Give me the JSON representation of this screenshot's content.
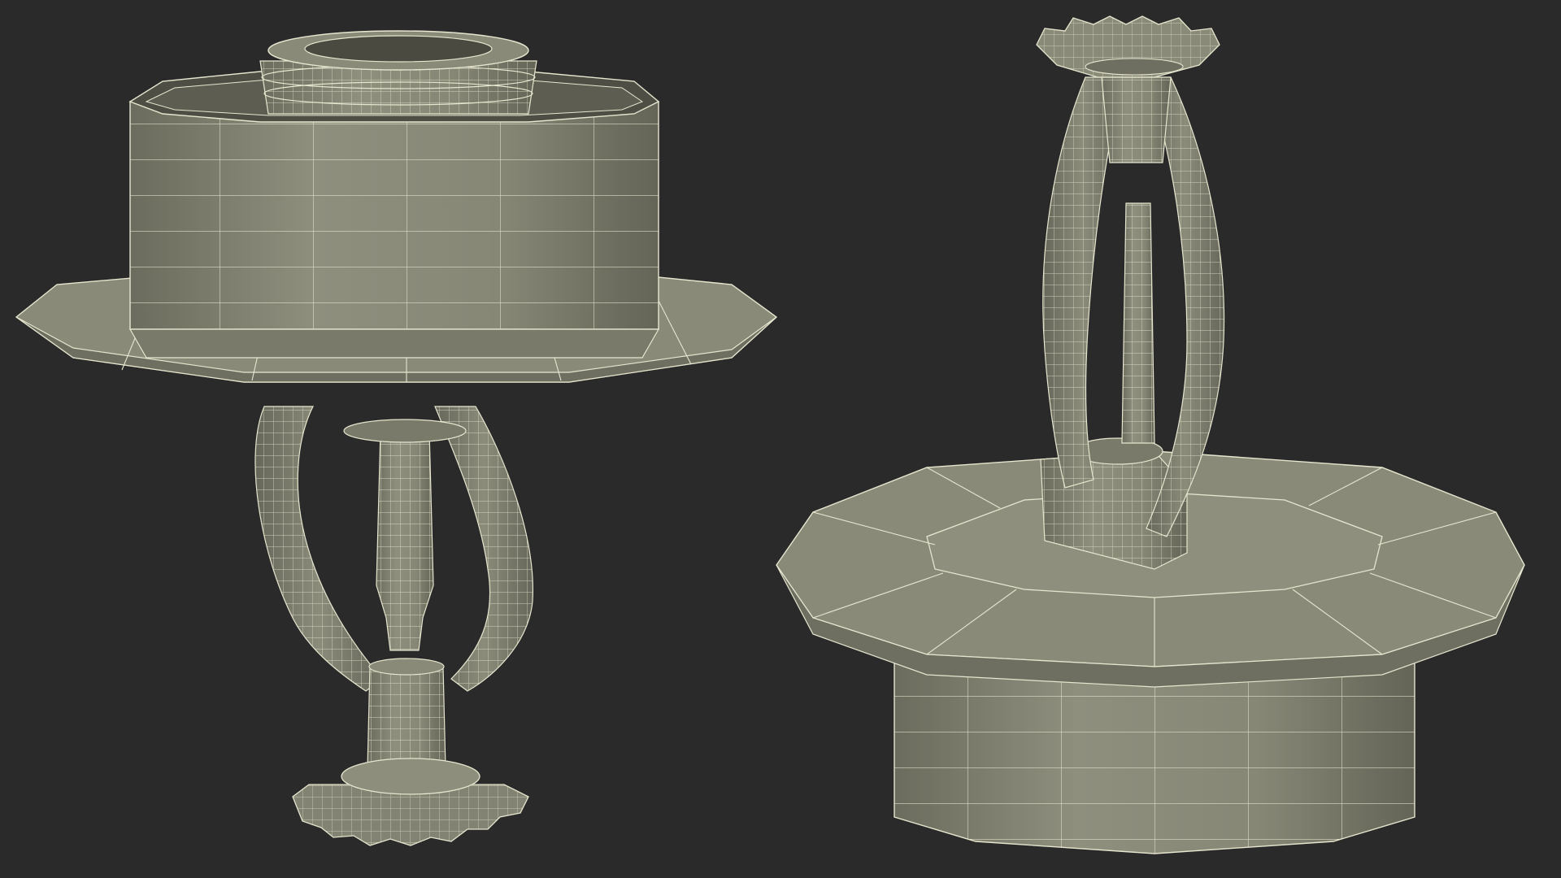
{
  "scene": {
    "background_color": "#2a2a2a",
    "mesh_fill": "#838373",
    "mesh_fill_light": "#9a9a88",
    "mesh_fill_dark": "#5f5f53",
    "wire_color": "#e6e6cf",
    "objects": [
      {
        "name": "sprinkler-pendent-view",
        "orientation": "pendent"
      },
      {
        "name": "sprinkler-upright-view",
        "orientation": "upright"
      }
    ]
  }
}
